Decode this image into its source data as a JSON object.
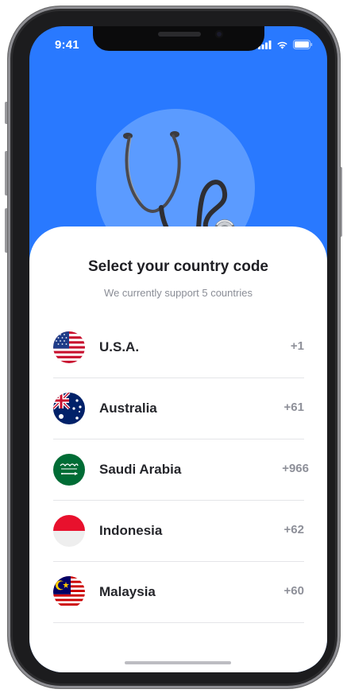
{
  "status_bar": {
    "time": "9:41"
  },
  "header": {
    "title": "Select your country code",
    "subtitle": "We currently support 5 countries"
  },
  "countries": [
    {
      "name": "U.S.A.",
      "code": "+1",
      "flag": "us-flag-icon"
    },
    {
      "name": "Australia",
      "code": "+61",
      "flag": "australia-flag-icon"
    },
    {
      "name": "Saudi Arabia",
      "code": "+966",
      "flag": "saudi-arabia-flag-icon"
    },
    {
      "name": "Indonesia",
      "code": "+62",
      "flag": "indonesia-flag-icon"
    },
    {
      "name": "Malaysia",
      "code": "+60",
      "flag": "malaysia-flag-icon"
    }
  ],
  "colors": {
    "accent": "#2979ff",
    "hero_circle": "#5b9bff",
    "text_primary": "#25262b",
    "text_secondary": "#8e9099"
  }
}
